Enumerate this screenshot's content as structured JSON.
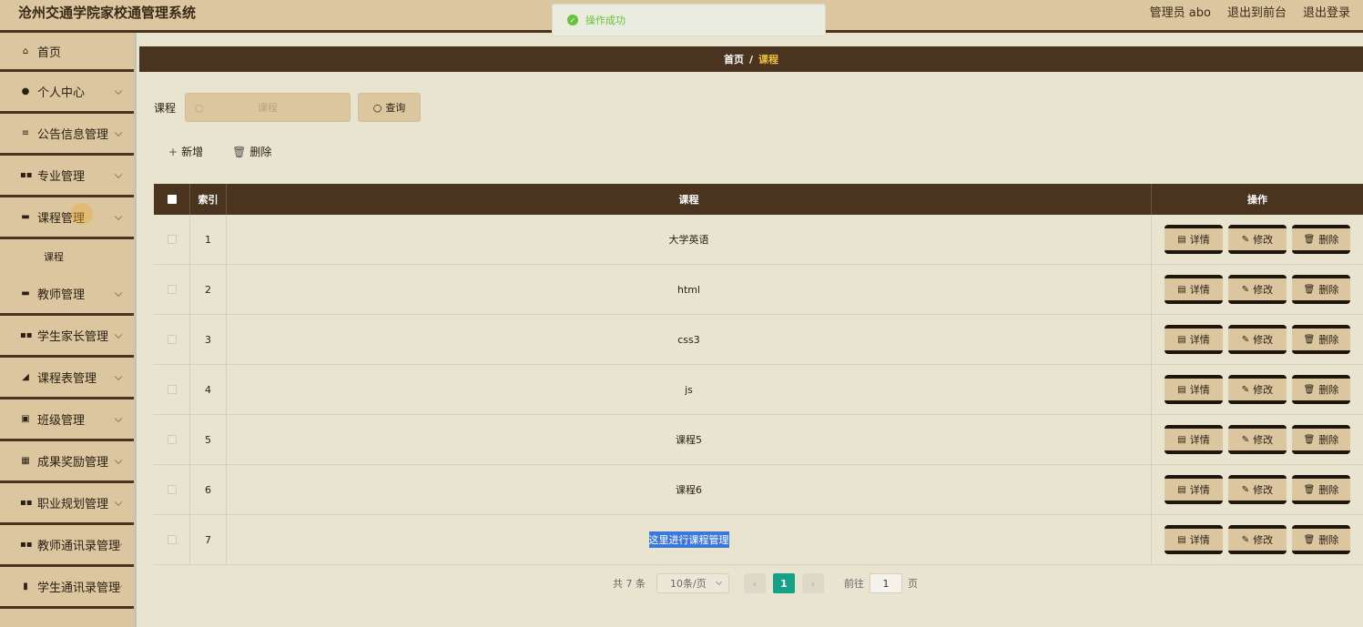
{
  "header": {
    "title": "沧州交通学院家校通管理系统",
    "user": "管理员 abo",
    "to_front": "退出到前台",
    "logout": "退出登录"
  },
  "toast": {
    "message": "操作成功"
  },
  "sidebar": {
    "home": "首页",
    "items": [
      {
        "label": "个人中心",
        "icon": "person-icon"
      },
      {
        "label": "公告信息管理",
        "icon": "list-icon"
      },
      {
        "label": "专业管理",
        "icon": "grid-icon"
      },
      {
        "label": "课程管理",
        "icon": "monitor-icon"
      },
      {
        "label": "教师管理",
        "icon": "monitor-icon"
      },
      {
        "label": "学生家长管理",
        "icon": "grid-icon"
      },
      {
        "label": "课程表管理",
        "icon": "chart-icon"
      },
      {
        "label": "班级管理",
        "icon": "calendar-icon"
      },
      {
        "label": "成果奖励管理",
        "icon": "apps-icon"
      },
      {
        "label": "职业规划管理",
        "icon": "grid-icon"
      },
      {
        "label": "教师通讯录管理",
        "icon": "grid-icon"
      },
      {
        "label": "学生通讯录管理",
        "icon": "book-icon"
      }
    ],
    "sub_course": "课程"
  },
  "breadcrumb": {
    "home": "首页",
    "sep": "/",
    "current": "课程"
  },
  "search": {
    "label": "课程",
    "placeholder": "课程",
    "button": "查询"
  },
  "actions": {
    "add": "新增",
    "delete": "删除"
  },
  "table": {
    "headers": {
      "index": "索引",
      "name": "课程",
      "ops": "操作"
    },
    "rows": [
      {
        "index": "1",
        "name": "大学英语"
      },
      {
        "index": "2",
        "name": "html"
      },
      {
        "index": "3",
        "name": "css3"
      },
      {
        "index": "4",
        "name": "js"
      },
      {
        "index": "5",
        "name": "课程5"
      },
      {
        "index": "6",
        "name": "课程6"
      },
      {
        "index": "7",
        "name": "这里进行课程管理"
      }
    ],
    "op_labels": {
      "detail": "详情",
      "edit": "修改",
      "delete": "删除"
    }
  },
  "pagination": {
    "total": "共 7 条",
    "page_size": "10条/页",
    "current_page": "1",
    "goto_label": "前往",
    "goto_value": "1",
    "page_unit": "页"
  }
}
